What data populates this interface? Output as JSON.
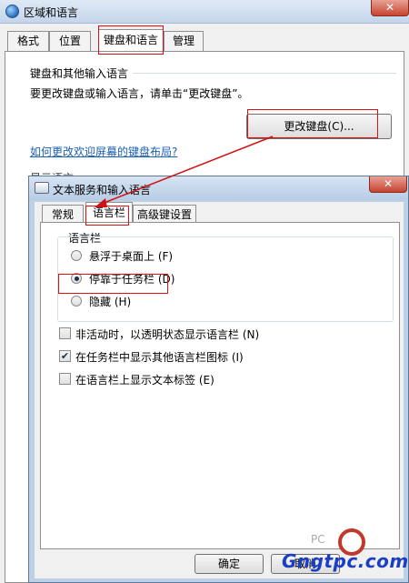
{
  "back_window": {
    "title": "区域和语言",
    "close_symbol": "✕",
    "tabs": [
      "格式",
      "位置",
      "键盘和语言",
      "管理"
    ],
    "group_title": "键盘和其他输入语言",
    "instruction": "要更改键盘或输入语言，请单击“更改键盘”。",
    "change_keyboard_button": "更改键盘(C)...",
    "help_link": "如何更改欢迎屏幕的键盘布局?",
    "display_language_partial": "显示语言"
  },
  "dialog": {
    "title": "文本服务和输入语言",
    "close_symbol": "✕",
    "tabs": [
      "常规",
      "语言栏",
      "高级键设置"
    ],
    "language_bar_group": "语言栏",
    "radios": [
      {
        "label": "悬浮于桌面上 (F)",
        "checked": false
      },
      {
        "label": "停靠于任务栏 (D)",
        "checked": true
      },
      {
        "label": "隐藏 (H)",
        "checked": false
      }
    ],
    "checkboxes": [
      {
        "label": "非活动时，以透明状态显示语言栏 (N)",
        "checked": false
      },
      {
        "label": "在任务栏中显示其他语言栏图标 (I)",
        "checked": true
      },
      {
        "label": "在语言栏上显示文本标签 (E)",
        "checked": false
      }
    ],
    "ok_button": "确定",
    "cancel_button_partial": "取消"
  },
  "watermark": {
    "site": "Gngtpc.com",
    "pc_mark": "PC"
  },
  "colors": {
    "annotation_red": "#d11111",
    "link_blue": "#1a5fb4"
  }
}
